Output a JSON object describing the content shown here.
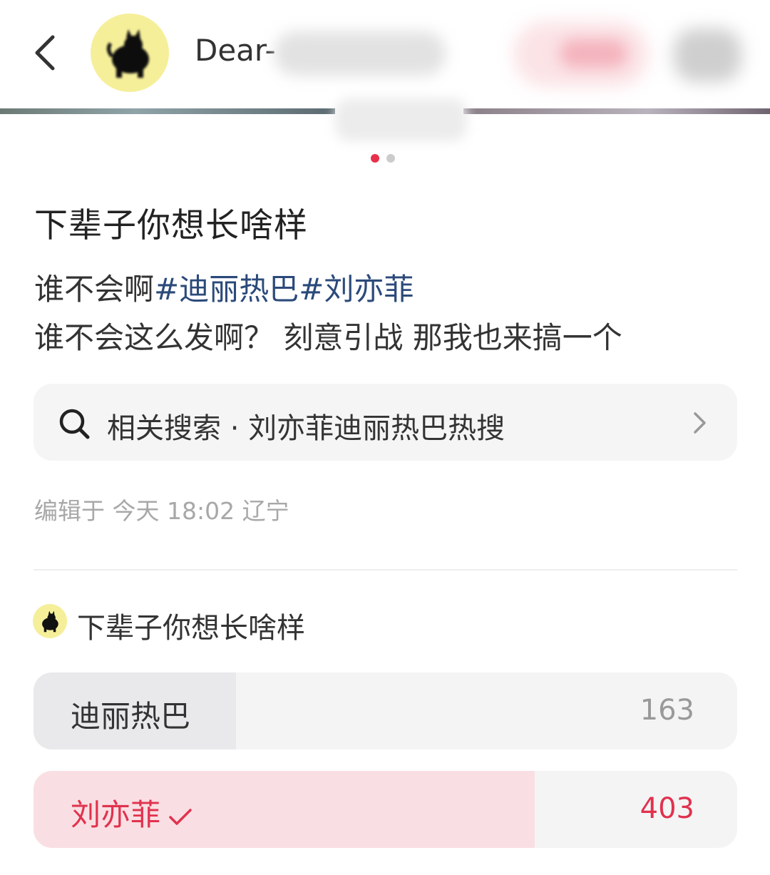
{
  "header": {
    "username_visible": "Dear-",
    "back_icon": "chevron-left-icon",
    "avatar_icon": "black-cat-icon"
  },
  "carousel": {
    "active_index": 1,
    "total": 2,
    "active_color": "#e8304a",
    "inactive_color": "#cccccc"
  },
  "post": {
    "title": "下辈子你想长啥样",
    "line1_text": "谁不会啊",
    "tags": [
      "#迪丽热巴",
      "#刘亦菲"
    ],
    "line2_text": "谁不会这么发啊？ 刻意引战 那我也来搞一个",
    "tag_color": "#2b4a7a"
  },
  "related_search": {
    "text": "相关搜索 · 刘亦菲迪丽热巴热搜",
    "icon": "search-icon",
    "chevron": "chevron-right-icon"
  },
  "meta": {
    "text": "编辑于 今天 18:02 辽宁"
  },
  "poll": {
    "title": "下辈子你想长啥样",
    "options": [
      {
        "label": "迪丽热巴",
        "count": "163",
        "fraction": 0.288,
        "selected": false,
        "fill_color": "#e9e9ec",
        "text_color": "#333333",
        "count_color": "#999999"
      },
      {
        "label": "刘亦菲",
        "count": "403",
        "fraction": 0.712,
        "selected": true,
        "fill_color": "#f9dfe3",
        "text_color": "#e0324e",
        "count_color": "#e0324e"
      }
    ]
  }
}
